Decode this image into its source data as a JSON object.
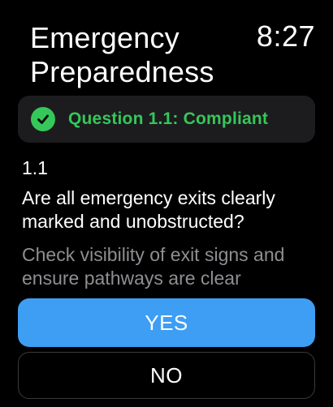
{
  "header": {
    "title_line1": "Emergency",
    "title_line2": "Preparedness",
    "time": "8:27"
  },
  "status": {
    "text": "Question 1.1: Compliant",
    "icon": "checkmark-circle-icon",
    "color": "#35c759"
  },
  "question": {
    "number": "1.1",
    "text": "Are all emergency exits clearly marked and unobstructed?",
    "hint": "Check visibility of exit signs and ensure pathways are clear"
  },
  "buttons": {
    "yes_label": "YES",
    "no_label": "NO",
    "yes_color": "#3d9ef4"
  }
}
